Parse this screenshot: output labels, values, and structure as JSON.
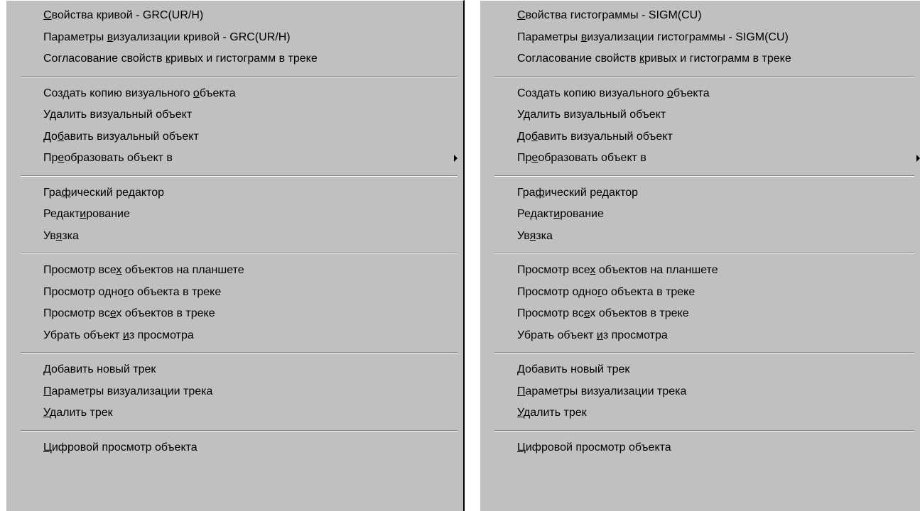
{
  "left_menu": {
    "groups": [
      [
        {
          "pre": "",
          "u": "С",
          "post": "войства кривой - GRC(UR/H)"
        },
        {
          "pre": "Параметры ",
          "u": "в",
          "post": "изуализации кривой - GRC(UR/H)"
        },
        {
          "pre": "Согласование свойств ",
          "u": "к",
          "post": "ривых и гистограмм в треке"
        }
      ],
      [
        {
          "pre": "Создать копию визуального ",
          "u": "о",
          "post": "бъекта"
        },
        {
          "pre": "У",
          "u": "д",
          "post": "алить визуальный объект"
        },
        {
          "pre": "До",
          "u": "б",
          "post": "авить визуальный объект"
        },
        {
          "pre": "Пр",
          "u": "е",
          "post": "образовать объект в",
          "submenu": true
        }
      ],
      [
        {
          "pre": "Гра",
          "u": "ф",
          "post": "ический редактор"
        },
        {
          "pre": "Редакт",
          "u": "и",
          "post": "рование"
        },
        {
          "pre": "Ув",
          "u": "я",
          "post": "зка"
        }
      ],
      [
        {
          "pre": "Просмотр все",
          "u": "х",
          "post": " объектов на планшете"
        },
        {
          "pre": "Просмотр одно",
          "u": "г",
          "post": "о объекта в треке"
        },
        {
          "pre": "Просмотр вс",
          "u": "е",
          "post": "х объектов в треке"
        },
        {
          "pre": "Убрать объект ",
          "u": "и",
          "post": "з просмотра"
        }
      ],
      [
        {
          "pre": "",
          "u": "Д",
          "post": "обавить новый трек"
        },
        {
          "pre": "",
          "u": "П",
          "post": "араметры визуализации трека"
        },
        {
          "pre": "",
          "u": "У",
          "post": "далить трек"
        }
      ],
      [
        {
          "pre": "",
          "u": "Ц",
          "post": "ифровой просмотр объекта"
        }
      ]
    ]
  },
  "right_menu": {
    "groups": [
      [
        {
          "pre": "",
          "u": "С",
          "post": "войства гистограммы - SIGM(CU)"
        },
        {
          "pre": "Параметры ",
          "u": "в",
          "post": "изуализации гистограммы - SIGM(CU)"
        },
        {
          "pre": "Согласование свойств ",
          "u": "к",
          "post": "ривых и гистограмм в треке"
        }
      ],
      [
        {
          "pre": "Создать копию визуального ",
          "u": "о",
          "post": "бъекта"
        },
        {
          "pre": "У",
          "u": "д",
          "post": "алить визуальный объект"
        },
        {
          "pre": "До",
          "u": "б",
          "post": "авить визуальный объект"
        },
        {
          "pre": "Пр",
          "u": "е",
          "post": "образовать объект в",
          "submenu": true
        }
      ],
      [
        {
          "pre": "Гра",
          "u": "ф",
          "post": "ический редактор"
        },
        {
          "pre": "Редакт",
          "u": "и",
          "post": "рование"
        },
        {
          "pre": "Ув",
          "u": "я",
          "post": "зка"
        }
      ],
      [
        {
          "pre": "Просмотр все",
          "u": "х",
          "post": " объектов на планшете"
        },
        {
          "pre": "Просмотр одно",
          "u": "г",
          "post": "о объекта в треке"
        },
        {
          "pre": "Просмотр вс",
          "u": "е",
          "post": "х объектов в треке"
        },
        {
          "pre": "Убрать объект ",
          "u": "и",
          "post": "з просмотра"
        }
      ],
      [
        {
          "pre": "",
          "u": "Д",
          "post": "обавить новый трек"
        },
        {
          "pre": "",
          "u": "П",
          "post": "араметры визуализации трека"
        },
        {
          "pre": "",
          "u": "У",
          "post": "далить трек"
        }
      ],
      [
        {
          "pre": "",
          "u": "Ц",
          "post": "ифровой просмотр объекта"
        }
      ]
    ]
  },
  "colors": {
    "menu_bg": "#c0c0c0",
    "separator_dark": "#808080",
    "separator_light": "#ffffff",
    "text": "#000000"
  },
  "icons": {
    "submenu": "submenu-arrow-icon"
  }
}
